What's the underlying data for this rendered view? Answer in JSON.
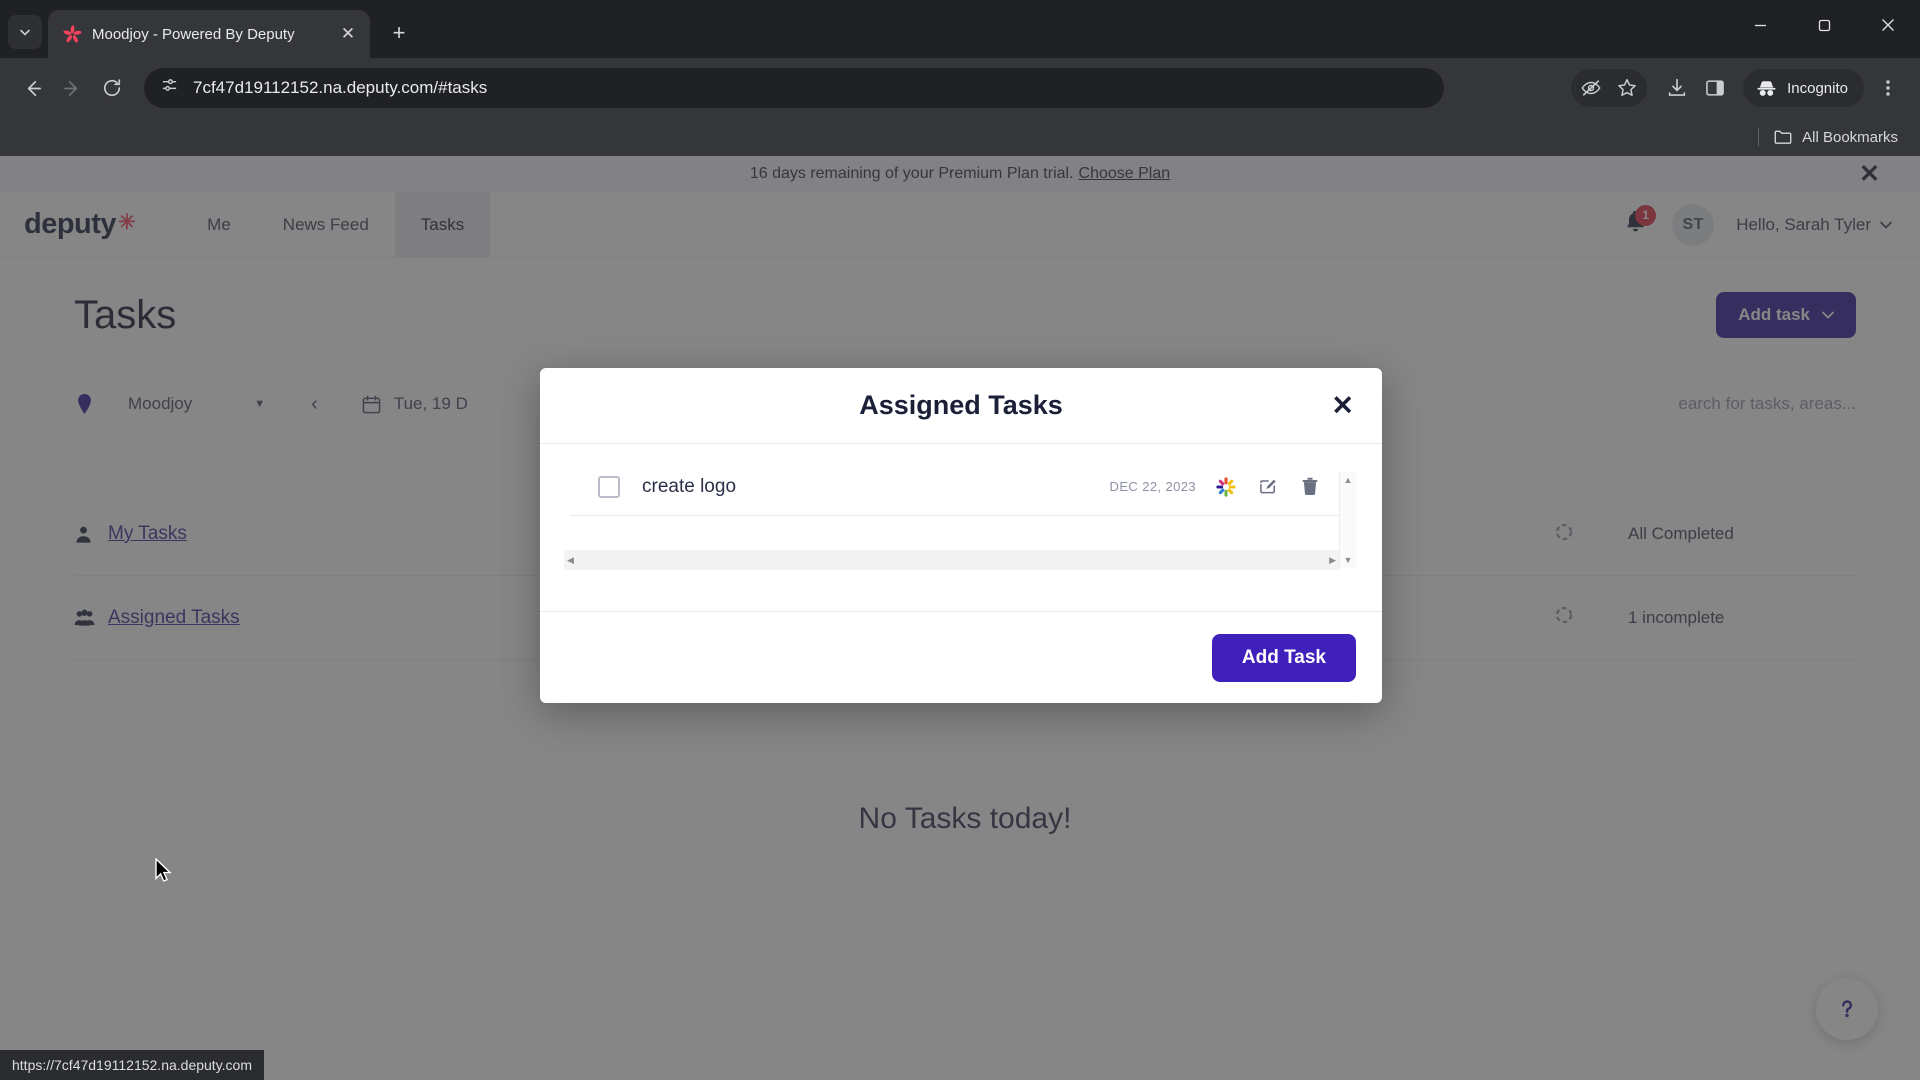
{
  "browser": {
    "tab": {
      "title": "Moodjoy - Powered By Deputy",
      "favicon_icon": "deputy-star-icon",
      "close_icon": "close-icon"
    },
    "tab_search_icon": "chevron-down-icon",
    "new_tab_icon": "plus-icon",
    "window_controls": {
      "minimize": "minimize-icon",
      "maximize": "maximize-icon",
      "close": "close-icon"
    },
    "nav": {
      "back_icon": "back-arrow-icon",
      "forward_icon": "forward-arrow-icon",
      "reload_icon": "reload-icon"
    },
    "omnibox": {
      "site_info_icon": "site-settings-icon",
      "url": "7cf47d19112152.na.deputy.com/#tasks"
    },
    "toolbar_right": {
      "tracking_icon": "eye-crossed-icon",
      "bookmark_icon": "star-icon",
      "downloads_icon": "download-icon",
      "side_panel_icon": "side-panel-icon",
      "incognito_icon": "incognito-hat-icon",
      "incognito_label": "Incognito",
      "menu_icon": "three-dot-menu-icon"
    },
    "bookmarks_bar": {
      "folder_icon": "folder-icon",
      "all_bookmarks_label": "All Bookmarks"
    },
    "status_bar": {
      "url": "https://7cf47d19112152.na.deputy.com"
    }
  },
  "banner": {
    "text": "16 days remaining of your Premium Plan trial.",
    "link_label": "Choose Plan",
    "close_icon": "close-icon"
  },
  "header": {
    "logo_text": "deputy",
    "logo_star_icon": "asterisk-icon",
    "nav_items": [
      {
        "label": "Me",
        "active": false
      },
      {
        "label": "News Feed",
        "active": false
      },
      {
        "label": "Tasks",
        "active": true
      }
    ],
    "notification_icon": "bell-icon",
    "notification_count": "1",
    "avatar_initials": "ST",
    "greeting": "Hello, Sarah Tyler",
    "greeting_chevron_icon": "chevron-down-icon"
  },
  "main": {
    "page_title": "Tasks",
    "add_task_button": "Add task",
    "add_task_chevron_icon": "chevron-down-icon",
    "filters": {
      "location_pin_icon": "location-pin-icon",
      "location_value": "Moodjoy",
      "location_chevron_icon": "chevron-down-icon",
      "prev_day_icon": "chevron-left-icon",
      "calendar_icon": "calendar-icon",
      "date_value": "Tue, 19 D",
      "search_placeholder": "earch for tasks, areas..."
    },
    "groups": [
      {
        "icon": "person-icon",
        "label": "My Tasks",
        "status_icon": "spinner-icon",
        "status": "All Completed"
      },
      {
        "icon": "group-icon",
        "label": "Assigned Tasks",
        "status_icon": "spinner-icon",
        "status": "1 incomplete"
      }
    ],
    "empty_message": "No Tasks today!",
    "help_icon": "question-mark-icon"
  },
  "modal": {
    "title": "Assigned Tasks",
    "close_icon": "close-icon",
    "tasks": [
      {
        "checkbox": "unchecked-checkbox",
        "name": "create logo",
        "date": "DEC 22, 2023",
        "spinner_icon": "loading-spinner-icon",
        "edit_icon": "edit-pencil-icon",
        "delete_icon": "trash-icon"
      }
    ],
    "scroll_up_icon": "caret-up-icon",
    "scroll_down_icon": "caret-down-icon",
    "scroll_left_icon": "caret-left-icon",
    "scroll_right_icon": "caret-right-icon",
    "add_task_button": "Add Task"
  },
  "colors": {
    "brand_purple": "#2f1a94",
    "modal_button": "#3f20ba",
    "link_purple": "#3a2f99",
    "logo_star_red": "#f5425d",
    "badge_red": "#e02f3c"
  }
}
